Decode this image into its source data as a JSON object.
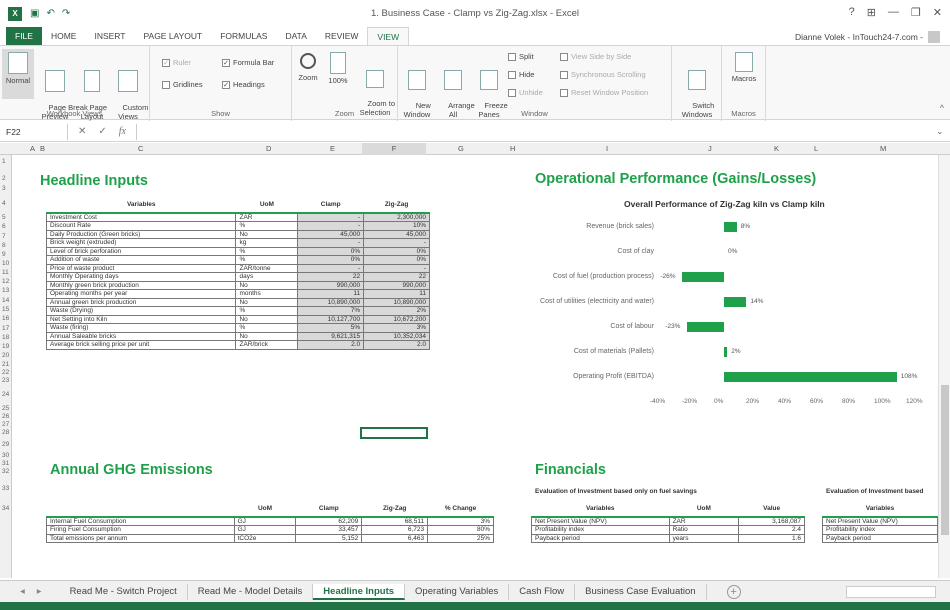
{
  "window": {
    "title": "1. Business Case - Clamp vs Zig-Zag.xlsx - Excel",
    "help": "?",
    "minimize": "—",
    "restore": "❐",
    "close": "✕"
  },
  "tabs": [
    "FILE",
    "HOME",
    "INSERT",
    "PAGE LAYOUT",
    "FORMULAS",
    "DATA",
    "REVIEW",
    "VIEW"
  ],
  "user": "Dianne Volek - InTouch24-7.com -",
  "ribbon": {
    "workbook_views": {
      "label": "Workbook Views",
      "normal": "Normal",
      "page_break": "Page Break\nPreview",
      "page_layout": "Page\nLayout",
      "custom": "Custom\nViews"
    },
    "show": {
      "label": "Show",
      "ruler": "Ruler",
      "formula_bar": "Formula Bar",
      "gridlines": "Gridlines",
      "headings": "Headings"
    },
    "zoom": {
      "label": "Zoom",
      "zoom": "Zoom",
      "z100": "100%",
      "zoom_sel": "Zoom to\nSelection"
    },
    "window": {
      "label": "Window",
      "new": "New\nWindow",
      "arrange": "Arrange\nAll",
      "freeze": "Freeze\nPanes",
      "split": "Split",
      "hide": "Hide",
      "unhide": "Unhide",
      "side": "View Side by Side",
      "sync": "Synchronous Scrolling",
      "reset": "Reset Window Position",
      "switch": "Switch\nWindows"
    },
    "macros": {
      "label": "Macros",
      "macros": "Macros"
    }
  },
  "formula_bar": {
    "name_box": "F22",
    "fx": "fx",
    "value": ""
  },
  "columns": [
    "A",
    "B",
    "C",
    "D",
    "E",
    "F",
    "G",
    "H",
    "I",
    "J",
    "K",
    "L",
    "M"
  ],
  "rows": [
    "1",
    "2",
    "3",
    "4",
    "5",
    "6",
    "7",
    "8",
    "9",
    "10",
    "11",
    "12",
    "13",
    "14",
    "15",
    "16",
    "17",
    "18",
    "19",
    "20",
    "21",
    "22",
    "23",
    "24",
    "25",
    "26",
    "27",
    "28",
    "29",
    "30",
    "31",
    "32",
    "33",
    "34"
  ],
  "headline": {
    "title": "Headline Inputs",
    "headers": [
      "Variables",
      "UoM",
      "Clamp",
      "Zig-Zag"
    ],
    "rows": [
      [
        "Investment Cost",
        "ZAR",
        "-",
        "2,300,000"
      ],
      [
        "Discount Rate",
        "%",
        "-",
        "10%"
      ],
      [
        "Daily Production (Green bricks)",
        "No",
        "45,000",
        "45,000"
      ],
      [
        "Brick weight (extruded)",
        "kg",
        "-",
        "-"
      ],
      [
        "Level of brick perforation",
        "%",
        "0%",
        "0%"
      ],
      [
        "Addition of waste",
        "%",
        "0%",
        "0%"
      ],
      [
        "Price of waste product",
        "ZAR/tonne",
        "-",
        "-"
      ],
      [
        "Monthly Operating days",
        "days",
        "22",
        "22"
      ],
      [
        "Monthly green brick production",
        "No",
        "990,000",
        "990,000"
      ],
      [
        "Operating months per year",
        "months",
        "11",
        "11"
      ],
      [
        "Annual green brick production",
        "No",
        "10,890,000",
        "10,890,000"
      ],
      [
        "Waste (Drying)",
        "%",
        "7%",
        "2%"
      ],
      [
        "Net Setting into Kiln",
        "No",
        "10,127,700",
        "10,672,200"
      ],
      [
        "Waste (firing)",
        "%",
        "5%",
        "3%"
      ],
      [
        "Annual Saleable bricks",
        "No",
        "9,621,315",
        "10,352,034"
      ],
      [
        "Average brick selling price per unit",
        "ZAR/brick",
        "2.0",
        "2.0"
      ]
    ]
  },
  "ghg": {
    "title": "Annual GHG Emissions",
    "headers": [
      "",
      "UoM",
      "Clamp",
      "Zig-Zag",
      "% Change"
    ],
    "rows": [
      [
        "Internal Fuel Consumption",
        "GJ",
        "62,209",
        "68,511",
        "3%"
      ],
      [
        "Firing Fuel Consumption",
        "GJ",
        "33,457",
        "6,723",
        "80%"
      ],
      [
        "Total emissions per annum",
        "tCO2e",
        "5,152",
        "6,463",
        "25%"
      ]
    ]
  },
  "operational": {
    "title": "Operational Performance (Gains/Losses)"
  },
  "chart_data": {
    "type": "bar",
    "orientation": "horizontal",
    "title": "Overall Performance of Zig-Zag kiln vs Clamp kiln",
    "categories": [
      "Revenue (brick sales)",
      "Cost of clay",
      "Cost of fuel (production process)",
      "Cost of utilities (electricity and water)",
      "Cost of labour",
      "Cost of materials (Pallets)",
      "Operating Profit (EBITDA)"
    ],
    "values": [
      8,
      0,
      -26,
      14,
      -23,
      2,
      108
    ],
    "value_labels": [
      "8%",
      "0%",
      "-26%",
      "14%",
      "-23%",
      "2%",
      "108%"
    ],
    "xlim": [
      -40,
      120
    ],
    "x_ticks": [
      "-40%",
      "-20%",
      "0%",
      "20%",
      "40%",
      "60%",
      "80%",
      "100%",
      "120%"
    ],
    "color": "#1fa04a"
  },
  "financials": {
    "title": "Financials",
    "sub1": "Evaluation of Investment based only on fuel savings",
    "sub2": "Evaluation of Investment based",
    "headers": [
      "Variables",
      "UoM",
      "Value"
    ],
    "rows": [
      [
        "Net Present Value (NPV)",
        "ZAR",
        "3,168,087"
      ],
      [
        "Profitability index",
        "Ratio",
        "2.4"
      ],
      [
        "Payback period",
        "years",
        "1.6"
      ]
    ],
    "headers2": [
      "Variables"
    ],
    "rows2": [
      [
        "Net Present Value (NPV)"
      ],
      [
        "Profitability index"
      ],
      [
        "Payback period"
      ]
    ]
  },
  "sheet_tabs": [
    "Read Me - Switch Project",
    "Read Me - Model Details",
    "Headline Inputs",
    "Operating Variables",
    "Cash Flow",
    "Business Case Evaluation"
  ],
  "active_sheet": "Headline Inputs"
}
